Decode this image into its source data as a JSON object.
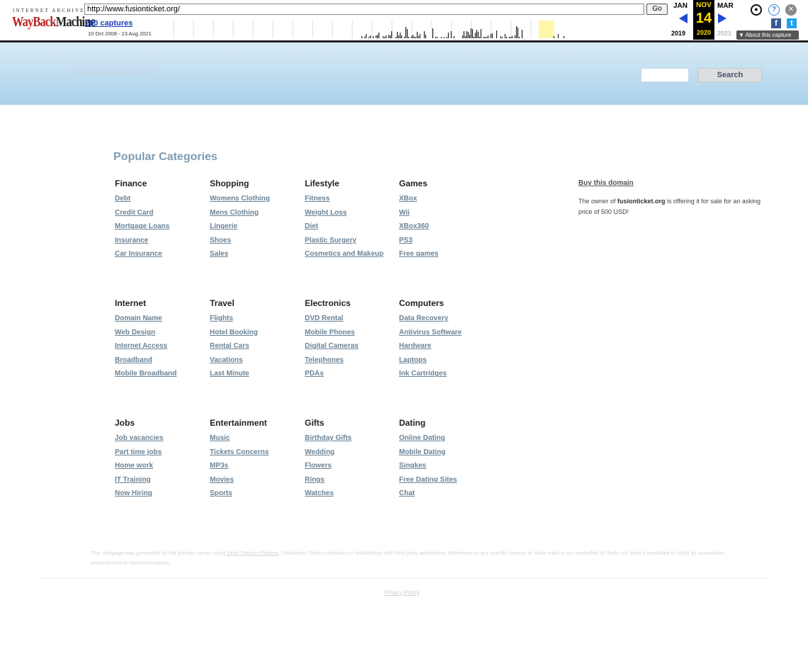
{
  "wayback": {
    "logo_top": "INTERNET ARCHIVE",
    "logo_main_a": "WayBack",
    "logo_main_b": "Machine",
    "url": "http://www.fusionticket.org/",
    "go_label": "Go",
    "captures": "250 captures",
    "range": "10 Oct 2008 - 23 Aug 2021",
    "prev_month": "JAN",
    "cur_month": "NOV",
    "next_month": "MAR",
    "cur_day": "14",
    "prev_year": "2019",
    "cur_year": "2020",
    "next_year": "2021",
    "about": "About this capture",
    "colors": {
      "accent": "#1f4bd4",
      "current": "#ffde00"
    }
  },
  "header": {
    "brand": "fusionticket.org",
    "search_label": "Search"
  },
  "main": {
    "heading": "Popular Categories",
    "groups": [
      {
        "title": "Finance",
        "links": [
          "Debt",
          "Credit Card",
          "Mortgage Loans",
          "Insurance",
          "Car Insurance"
        ]
      },
      {
        "title": "Shopping",
        "links": [
          "Womens Clothing",
          "Mens Clothing",
          "Lingerie",
          "Shoes",
          "Sales"
        ]
      },
      {
        "title": "Lifestyle",
        "links": [
          "Fitness",
          "Weight Loss",
          "Diet",
          "Plastic Surgery",
          "Cosmetics and Makeup"
        ]
      },
      {
        "title": "Games",
        "links": [
          "XBox",
          "Wii",
          "XBox360",
          "PS3",
          "Free games"
        ]
      },
      {
        "title": "Internet",
        "links": [
          "Domain Name",
          "Web Design",
          "Internet Access",
          "Broadband",
          "Mobile Broadband"
        ]
      },
      {
        "title": "Travel",
        "links": [
          "Flights",
          "Hotel Booking",
          "Rental Cars",
          "Vacations",
          "Last Minute"
        ]
      },
      {
        "title": "Electronics",
        "links": [
          "DVD Rental",
          "Mobile Phones",
          "Digital Cameras",
          "Telephones",
          "PDAs"
        ]
      },
      {
        "title": "Computers",
        "links": [
          "Data Recovery",
          "Antivirus Software",
          "Hardware",
          "Laptops",
          "Ink Cartridges"
        ]
      },
      {
        "title": "Jobs",
        "links": [
          "Job vacancies",
          "Part time jobs",
          "Home work",
          "IT Training",
          "Now Hiring"
        ]
      },
      {
        "title": "Entertainment",
        "links": [
          "Music",
          "Tickets Concerns",
          "MP3s",
          "Movies",
          "Sports"
        ]
      },
      {
        "title": "Gifts",
        "links": [
          "Birthday Gifts",
          "Wedding",
          "Flowers",
          "Rings",
          "Watches"
        ]
      },
      {
        "title": "Dating",
        "links": [
          "Online Dating",
          "Mobile Dating",
          "Singkes",
          "Free Dating Sites",
          "Chat"
        ]
      }
    ]
  },
  "sidebar": {
    "buy_title": "Buy this domain",
    "text_pre": "The owner of ",
    "domain": "fusionticket.org",
    "text_post": " is offering it for sale for an asking price of 500 USD!"
  },
  "footer": {
    "disclaimer_pre": "This webpage was generated by the domain owner using ",
    "disclaimer_link": "Sedo Domain Parking",
    "disclaimer_post": ". Disclaimer: Sedo maintains no relationship with third party advertisers. Reference to any specific service or trade mark is not controlled by Sedo nor does it constitute or imply its association, endorsement or recommendation.",
    "privacy": "Privacy Policy"
  }
}
